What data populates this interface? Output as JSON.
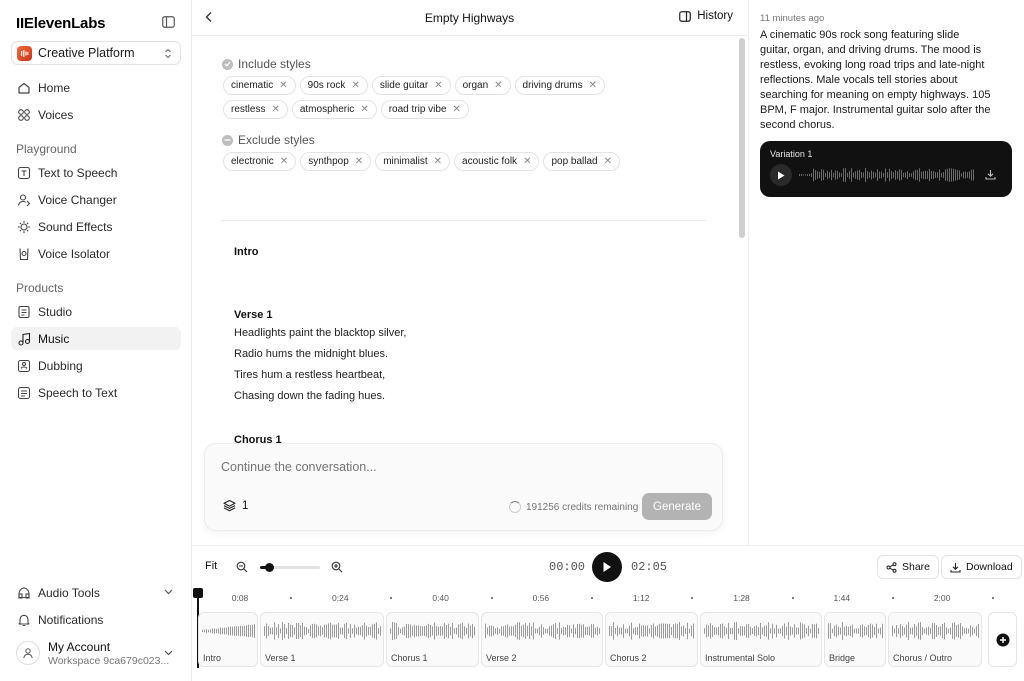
{
  "sidebar": {
    "logo": "IIElevenLabs",
    "workspace_label": "Creative Platform",
    "top_items": [
      {
        "label": "Home",
        "icon": "home-icon"
      },
      {
        "label": "Voices",
        "icon": "voices-icon"
      }
    ],
    "playground_label": "Playground",
    "playground_items": [
      {
        "label": "Text to Speech",
        "icon": "text-to-speech-icon"
      },
      {
        "label": "Voice Changer",
        "icon": "voice-changer-icon"
      },
      {
        "label": "Sound Effects",
        "icon": "sound-effects-icon"
      },
      {
        "label": "Voice Isolator",
        "icon": "voice-isolator-icon"
      }
    ],
    "products_label": "Products",
    "product_items": [
      {
        "label": "Studio",
        "icon": "studio-icon"
      },
      {
        "label": "Music",
        "icon": "music-icon",
        "active": true
      },
      {
        "label": "Dubbing",
        "icon": "dubbing-icon"
      },
      {
        "label": "Speech to Text",
        "icon": "speech-to-text-icon"
      }
    ],
    "bottom_items": [
      {
        "label": "Audio Tools",
        "icon": "audio-tools-icon"
      },
      {
        "label": "Notifications",
        "icon": "bell-icon"
      }
    ],
    "account_name": "My Account",
    "account_workspace": "Workspace 9ca679c023..."
  },
  "header": {
    "title": "Empty Highways",
    "history_label": "History"
  },
  "styles": {
    "include_label": "Include styles",
    "include": [
      "cinematic",
      "90s rock",
      "slide guitar",
      "organ",
      "driving drums",
      "restless",
      "atmospheric",
      "road trip vibe"
    ],
    "exclude_label": "Exclude styles",
    "exclude": [
      "electronic",
      "synthpop",
      "minimalist",
      "acoustic folk",
      "pop ballad"
    ]
  },
  "lyrics": {
    "intro_head": "Intro",
    "verse1_head": "Verse 1",
    "verse1_lines": [
      "Headlights paint the blacktop silver,",
      "Radio hums the midnight blues.",
      "Tires hum a restless heartbeat,",
      "Chasing down the fading hues."
    ],
    "chorus1_head": "Chorus 1"
  },
  "composer": {
    "placeholder": "Continue the conversation...",
    "layers_count": "1",
    "credits": "191256 credits remaining",
    "generate_label": "Generate"
  },
  "right_panel": {
    "time_ago": "11 minutes ago",
    "description": "A cinematic 90s rock song featuring slide guitar, organ, and driving drums. The mood is restless, evoking long road trips and late-night reflections. Male vocals tell stories about searching for meaning on empty highways. 105 BPM, F major. Instrumental guitar solo after the second chorus.",
    "variation_label": "Variation 1"
  },
  "timeline": {
    "fit_label": "Fit",
    "current_time": "00:00",
    "total_time": "02:05",
    "share_label": "Share",
    "download_label": "Download",
    "zoom_level": 0.15,
    "ruler_labels": [
      "0:08",
      "0:24",
      "0:40",
      "0:56",
      "1:12",
      "1:28",
      "1:44",
      "2:00"
    ],
    "segments": [
      "Intro",
      "Verse 1",
      "Chorus 1",
      "Verse 2",
      "Chorus 2",
      "Instrumental Solo",
      "Bridge",
      "Chorus / Outro"
    ]
  },
  "colors": {
    "accent": "#111111",
    "workspace_icon": "#e4532b",
    "generate_disabled": "#b3b3b3"
  }
}
